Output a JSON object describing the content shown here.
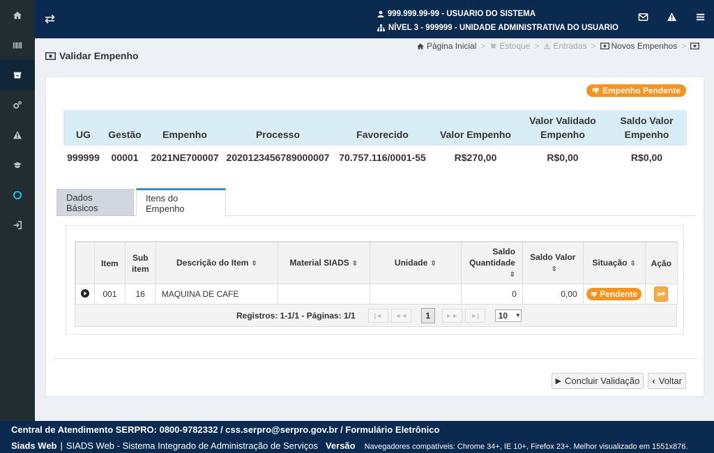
{
  "header": {
    "user_line": "999.999.99-99 - USUARIO DO SISTEMA",
    "unit_line": "NÍVEL 3 - 999999 - UNIDADE ADMINISTRATIVA DO USUARIO"
  },
  "page": {
    "title": "Validar Empenho"
  },
  "breadcrumb": {
    "home": "Página Inicial",
    "estoque": "Estoque",
    "entradas": "Entradas",
    "novos": "Novos Empenhos",
    "sep": ">"
  },
  "status_badge": "Empenho Pendente",
  "summary": {
    "headers": [
      "UG",
      "Gestão",
      "Empenho",
      "Processo",
      "Favorecido",
      "Valor Empenho",
      "Valor Validado Empenho",
      "Saldo Valor Empenho"
    ],
    "values": [
      "999999",
      "00001",
      "2021NE700007",
      "2020123456789000007",
      "70.757.116/0001-55",
      "R$270,00",
      "R$0,00",
      "R$0,00"
    ]
  },
  "tabs": [
    "Dados Básicos",
    "Itens do Empenho"
  ],
  "grid": {
    "headers": [
      "Item",
      "Sub item",
      "Descrição do Item",
      "Material SIADS",
      "Unidade",
      "Saldo Quantidade",
      "Saldo Valor",
      "Situação",
      "Ação"
    ],
    "rows": [
      {
        "item": "001",
        "subitem": "16",
        "descricao": "MAQUINA DE CAFE",
        "material": "",
        "unidade": "",
        "saldo_qtd": "0",
        "saldo_valor": "0,00",
        "situacao": "Pendente"
      }
    ]
  },
  "pager": {
    "info": "Registros: 1-1/1 - Páginas: 1/1",
    "current": "1",
    "per_page": "10"
  },
  "buttons": {
    "concluir": "Concluir Validação",
    "voltar": "Voltar"
  },
  "footer": {
    "line1": "Central de Atendimento SERPRO: 0800-9782332 / css.serpro@serpro.gov.br / Formulário Eletrônico",
    "brand": "Siads Web",
    "sep": "|",
    "system": "SIADS Web - Sistema Integrado de Administração de Serviços",
    "version": "Versão",
    "browsers": "Navegadores compatíveis: Chrome 34+, IE 10+, Firefox 23+. Melhor visualizado em 1551x876."
  },
  "colors": {
    "header_bg": "#0b2a4f",
    "sidebar_bg": "#222d32",
    "badge": "#f7931e",
    "summary_head": "#d9edf7"
  }
}
